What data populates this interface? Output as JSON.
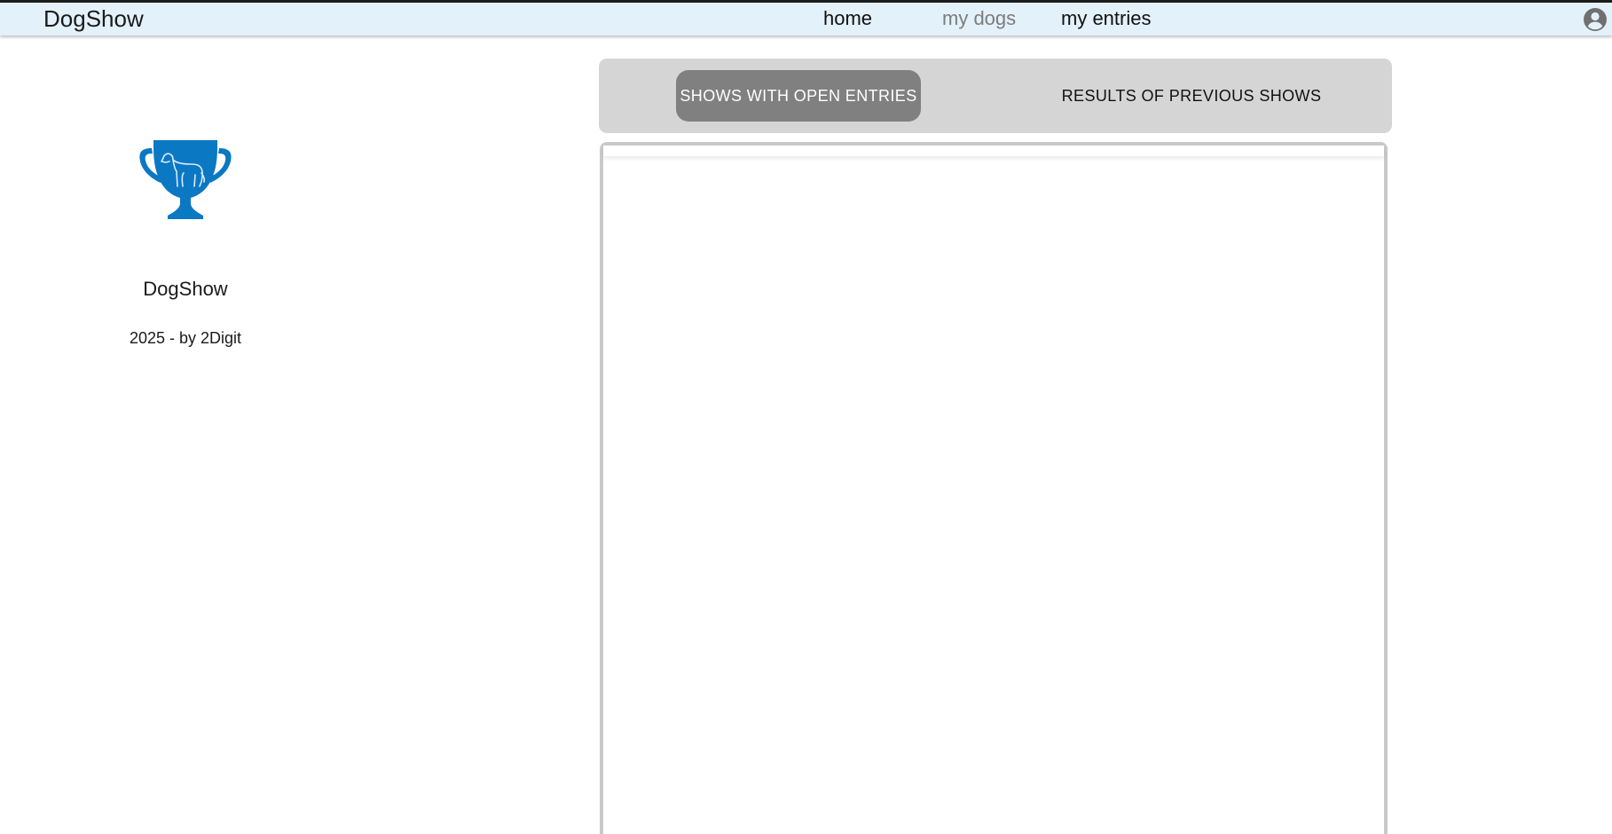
{
  "appbar": {
    "brand": "DogShow",
    "nav": {
      "home": "home",
      "my_dogs": "my dogs",
      "my_entries": "my entries"
    },
    "account_icon": "account-circle-icon"
  },
  "sidebar": {
    "logo_icon": "trophy-dog-icon",
    "logo_color": "#0b78c4",
    "title": "DogShow",
    "subtitle": "2025 - by 2Digit"
  },
  "tabs": {
    "open_entries": "SHOWS WITH OPEN ENTRIES",
    "previous_results": "RESULTS OF PREVIOUS SHOWS",
    "selected": "open_entries"
  },
  "colors": {
    "appbar_bg": "#e3f1fb",
    "tab_bar_bg": "#d5d5d5",
    "tab_selected_bg": "#808080",
    "nav_inactive": "#7c7c7c"
  }
}
